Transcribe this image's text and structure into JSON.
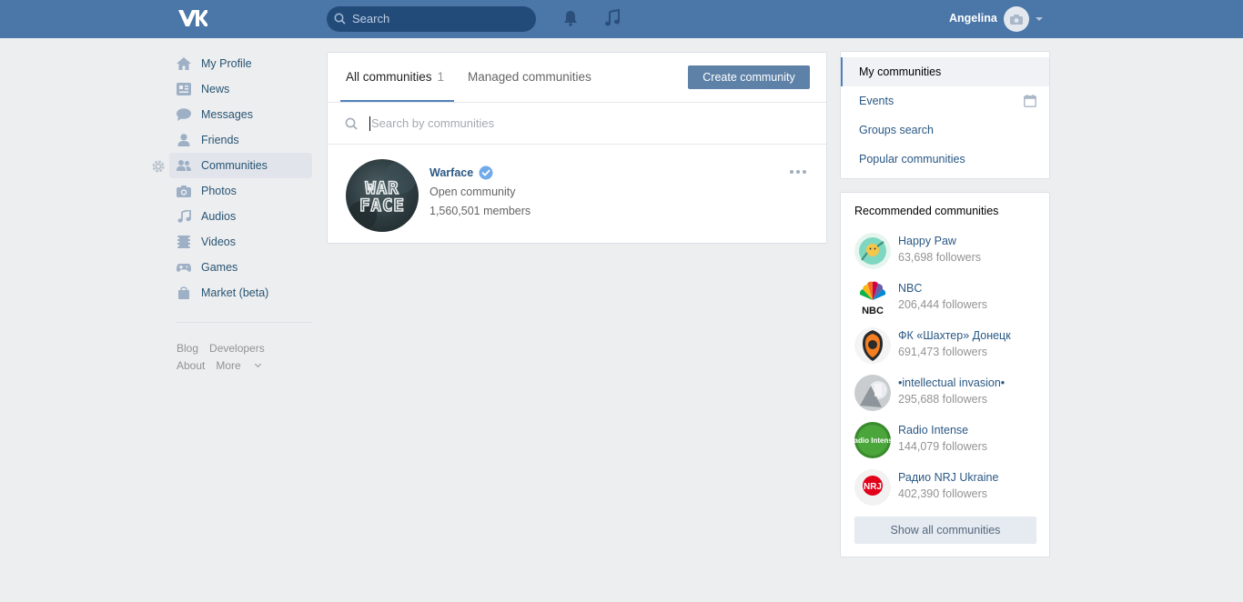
{
  "header": {
    "search_placeholder": "Search",
    "user_name": "Angelina"
  },
  "leftnav": {
    "items": [
      {
        "label": "My Profile",
        "icon": "home-icon"
      },
      {
        "label": "News",
        "icon": "news-icon"
      },
      {
        "label": "Messages",
        "icon": "messages-icon"
      },
      {
        "label": "Friends",
        "icon": "friend-icon"
      },
      {
        "label": "Communities",
        "icon": "communities-icon",
        "active": true
      },
      {
        "label": "Photos",
        "icon": "camera-icon"
      },
      {
        "label": "Audios",
        "icon": "music-note-icon"
      },
      {
        "label": "Videos",
        "icon": "film-icon"
      },
      {
        "label": "Games",
        "icon": "gamepad-icon"
      },
      {
        "label": "Market (beta)",
        "icon": "shopping-bag-icon"
      }
    ],
    "footer": {
      "blog": "Blog",
      "developers": "Developers",
      "about": "About",
      "more": "More"
    }
  },
  "main": {
    "tabs": [
      {
        "label": "All communities",
        "count": "1"
      },
      {
        "label": "Managed communities"
      }
    ],
    "create_button": "Create community",
    "search_placeholder": "Search by communities",
    "group": {
      "name": "Warface",
      "avatar_text": "WAR FACE",
      "type": "Open community",
      "members": "1,560,501 members"
    }
  },
  "rightmenu": {
    "items": [
      {
        "label": "My communities",
        "active": true
      },
      {
        "label": "Events"
      },
      {
        "label": "Groups search"
      },
      {
        "label": "Popular communities"
      }
    ]
  },
  "recommended": {
    "title": "Recommended communities",
    "items": [
      {
        "name": "Happy Paw",
        "followers": "63,698 followers"
      },
      {
        "name": "NBC",
        "followers": "206,444 followers",
        "avatar_text": "NBC"
      },
      {
        "name": "ФК «Шахтер» Донецк",
        "followers": "691,473 followers"
      },
      {
        "name": "•intellectual invasion•",
        "followers": "295,688 followers"
      },
      {
        "name": "Radio Intense",
        "followers": "144,079 followers",
        "avatar_text": "Radio Intense"
      },
      {
        "name": "Радио NRJ Ukraine",
        "followers": "402,390 followers",
        "avatar_text": "NRJ"
      }
    ],
    "show_all": "Show all communities"
  },
  "colors": {
    "header_bg": "#4a76a8",
    "link": "#2a5885",
    "button": "#5e81a8",
    "page_bg": "#edeef0"
  }
}
